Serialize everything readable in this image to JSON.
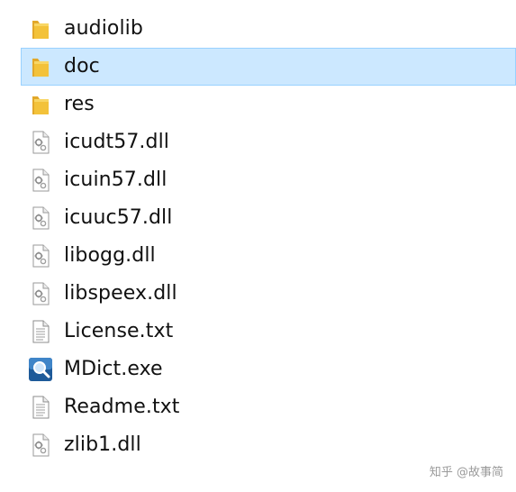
{
  "files": [
    {
      "name": "audiolib",
      "type": "folder",
      "selected": false
    },
    {
      "name": "doc",
      "type": "folder",
      "selected": true
    },
    {
      "name": "res",
      "type": "folder",
      "selected": false
    },
    {
      "name": "icudt57.dll",
      "type": "dll",
      "selected": false
    },
    {
      "name": "icuin57.dll",
      "type": "dll",
      "selected": false
    },
    {
      "name": "icuuc57.dll",
      "type": "dll",
      "selected": false
    },
    {
      "name": "libogg.dll",
      "type": "dll",
      "selected": false
    },
    {
      "name": "libspeex.dll",
      "type": "dll",
      "selected": false
    },
    {
      "name": "License.txt",
      "type": "txt",
      "selected": false
    },
    {
      "name": "MDict.exe",
      "type": "exe",
      "selected": false
    },
    {
      "name": "Readme.txt",
      "type": "txt",
      "selected": false
    },
    {
      "name": "zlib1.dll",
      "type": "dll",
      "selected": false
    }
  ],
  "icons": {
    "folder": "folder-icon",
    "dll": "dll-settings-icon",
    "txt": "text-document-icon",
    "exe": "mdict-app-icon"
  },
  "colors": {
    "selection_bg": "#cce8ff",
    "selection_border": "#99d1ff",
    "folder": "#f3c23a"
  },
  "watermark": {
    "text": "知乎 @故事简"
  }
}
